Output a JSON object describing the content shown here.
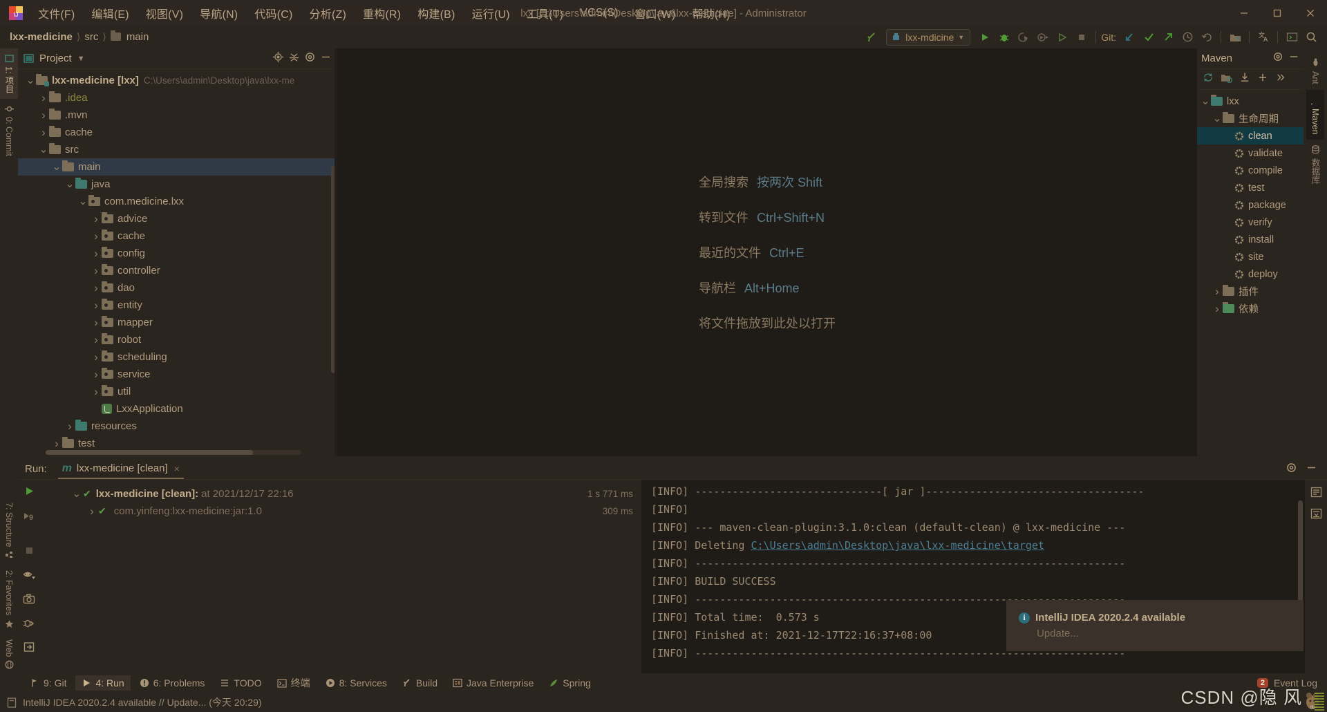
{
  "titlebar": {
    "window_title": "lxx [C:\\Users\\admin\\Desktop\\java\\lxx-medicine] - Administrator",
    "menus": [
      {
        "label": "文件(F)"
      },
      {
        "label": "编辑(E)"
      },
      {
        "label": "视图(V)"
      },
      {
        "label": "导航(N)"
      },
      {
        "label": "代码(C)"
      },
      {
        "label": "分析(Z)"
      },
      {
        "label": "重构(R)"
      },
      {
        "label": "构建(B)"
      },
      {
        "label": "运行(U)"
      },
      {
        "label": "工具(T)"
      },
      {
        "label": "VCS(S)"
      },
      {
        "label": "窗口(W)"
      },
      {
        "label": "帮助(H)"
      }
    ],
    "window_controls": [
      "minimize-button",
      "maximize-button",
      "close-button"
    ]
  },
  "navbar": {
    "breadcrumbs": [
      {
        "label": "lxx-medicine",
        "bold": true
      },
      {
        "label": "src",
        "bold": false
      },
      {
        "label": "main",
        "bold": false,
        "folder": true
      }
    ],
    "run_config": "lxx-mdicine",
    "git_label": "Git:",
    "toolbar_icons": [
      "build-hammer-icon",
      "run-button",
      "debug-button",
      "run-coverage-icon",
      "profiler-icon",
      "attach-icon",
      "stop-button",
      "update-project-icon",
      "commit-icon",
      "push-icon",
      "history-icon",
      "rollback-icon",
      "project-structure-icon",
      "translate-icon",
      "terminal-icon",
      "search-icon"
    ]
  },
  "left_tool_tabs": [
    {
      "label": "1: 项目",
      "active": true,
      "icon": "project-icon"
    },
    {
      "label": "0: Commit",
      "active": false,
      "icon": "commit-icon"
    }
  ],
  "left_tool_tabs_bottom": [
    {
      "label": "7: Structure",
      "icon": "structure-icon"
    },
    {
      "label": "2: Favorites",
      "icon": "star-icon"
    },
    {
      "label": "Web",
      "icon": "globe-icon"
    }
  ],
  "project_panel": {
    "title": "Project",
    "header_icons": [
      "locate-target-icon",
      "collapse-all-icon",
      "gear-icon",
      "hide-icon"
    ],
    "tree": [
      {
        "depth": 0,
        "arrow": "down",
        "icon": "module-folder",
        "label": "lxx-medicine [lxx]",
        "bold": true,
        "path": "C:\\Users\\admin\\Desktop\\java\\lxx-me"
      },
      {
        "depth": 1,
        "arrow": "right",
        "icon": "folder",
        "label": ".idea",
        "yellow": true
      },
      {
        "depth": 1,
        "arrow": "right",
        "icon": "folder",
        "label": ".mvn"
      },
      {
        "depth": 1,
        "arrow": "right",
        "icon": "folder",
        "label": "cache"
      },
      {
        "depth": 1,
        "arrow": "down",
        "icon": "folder",
        "label": "src"
      },
      {
        "depth": 2,
        "arrow": "down",
        "icon": "folder",
        "label": "main",
        "selected": true
      },
      {
        "depth": 3,
        "arrow": "down",
        "icon": "source-folder",
        "label": "java"
      },
      {
        "depth": 4,
        "arrow": "down",
        "icon": "package",
        "label": "com.medicine.lxx"
      },
      {
        "depth": 5,
        "arrow": "right",
        "icon": "package",
        "label": "advice"
      },
      {
        "depth": 5,
        "arrow": "right",
        "icon": "package",
        "label": "cache"
      },
      {
        "depth": 5,
        "arrow": "right",
        "icon": "package",
        "label": "config"
      },
      {
        "depth": 5,
        "arrow": "right",
        "icon": "package",
        "label": "controller"
      },
      {
        "depth": 5,
        "arrow": "right",
        "icon": "package",
        "label": "dao"
      },
      {
        "depth": 5,
        "arrow": "right",
        "icon": "package",
        "label": "entity"
      },
      {
        "depth": 5,
        "arrow": "right",
        "icon": "package",
        "label": "mapper"
      },
      {
        "depth": 5,
        "arrow": "right",
        "icon": "package",
        "label": "robot"
      },
      {
        "depth": 5,
        "arrow": "right",
        "icon": "package",
        "label": "scheduling"
      },
      {
        "depth": 5,
        "arrow": "right",
        "icon": "package",
        "label": "service"
      },
      {
        "depth": 5,
        "arrow": "right",
        "icon": "package",
        "label": "util"
      },
      {
        "depth": 5,
        "arrow": "none",
        "icon": "java-class",
        "label": "LxxApplication"
      },
      {
        "depth": 3,
        "arrow": "right",
        "icon": "resource-folder",
        "label": "resources"
      },
      {
        "depth": 2,
        "arrow": "right",
        "icon": "folder",
        "label": "test"
      }
    ]
  },
  "editor": {
    "welcome_rows": [
      {
        "action": "全局搜索",
        "key": "按两次 Shift"
      },
      {
        "action": "转到文件",
        "key": "Ctrl+Shift+N"
      },
      {
        "action": "最近的文件",
        "key": "Ctrl+E"
      },
      {
        "action": "导航栏",
        "key": "Alt+Home"
      }
    ],
    "drop_hint": "将文件拖放到此处以打开"
  },
  "maven_panel": {
    "title": "Maven",
    "header_icons": [
      "gear-icon",
      "hide-icon"
    ],
    "toolbar_icons": [
      "reload-icon",
      "add-module-icon",
      "download-sources-icon",
      "plus-icon",
      "more-icon"
    ],
    "tree": [
      {
        "depth": 0,
        "arrow": "down",
        "icon": "maven-project-icon",
        "label": "lxx"
      },
      {
        "depth": 1,
        "arrow": "down",
        "icon": "lifecycle-folder-icon",
        "label": "生命周期"
      },
      {
        "depth": 2,
        "arrow": "none",
        "icon": "gear-icon",
        "label": "clean",
        "selected": true
      },
      {
        "depth": 2,
        "arrow": "none",
        "icon": "gear-icon",
        "label": "validate"
      },
      {
        "depth": 2,
        "arrow": "none",
        "icon": "gear-icon",
        "label": "compile"
      },
      {
        "depth": 2,
        "arrow": "none",
        "icon": "gear-icon",
        "label": "test"
      },
      {
        "depth": 2,
        "arrow": "none",
        "icon": "gear-icon",
        "label": "package"
      },
      {
        "depth": 2,
        "arrow": "none",
        "icon": "gear-icon",
        "label": "verify"
      },
      {
        "depth": 2,
        "arrow": "none",
        "icon": "gear-icon",
        "label": "install"
      },
      {
        "depth": 2,
        "arrow": "none",
        "icon": "gear-icon",
        "label": "site"
      },
      {
        "depth": 2,
        "arrow": "none",
        "icon": "gear-icon",
        "label": "deploy"
      },
      {
        "depth": 1,
        "arrow": "right",
        "icon": "plugins-folder-icon",
        "label": "插件"
      },
      {
        "depth": 1,
        "arrow": "right",
        "icon": "dependencies-icon",
        "label": "依赖"
      }
    ]
  },
  "right_tool_tabs": [
    {
      "label": "Ant",
      "active": false,
      "icon": "ant-icon"
    },
    {
      "label": "Maven",
      "active": true,
      "icon": "maven-m-icon"
    },
    {
      "label": "数据库",
      "active": false,
      "icon": "database-icon"
    }
  ],
  "run_panel": {
    "label": "Run:",
    "tab_title": "lxx-medicine [clean]",
    "tab_close": "×",
    "header_icons": [
      "gear-icon",
      "hide-icon"
    ],
    "gutter_icons": [
      "rerun-button",
      "rerun-failed-icon",
      "stop-button",
      "toggle-visibility-icon",
      "screenshot-icon",
      "debug-bug-icon",
      "export-icon",
      "more-icon"
    ],
    "right_gutter_icons": [
      "wrap-text-icon",
      "scroll-to-end-icon"
    ],
    "tree": [
      {
        "depth": 0,
        "arrow": "down",
        "name": "lxx-medicine [clean]:",
        "meta": "at 2021/12/17 22:16",
        "time": "1 s 771 ms"
      },
      {
        "depth": 1,
        "arrow": "right",
        "name": "",
        "meta": "com.yinfeng:lxx-medicine:jar:1.0",
        "time": "309 ms"
      }
    ],
    "console_lines": [
      {
        "text": "[INFO] ------------------------------[ jar ]-----------------------------------"
      },
      {
        "text": "[INFO] "
      },
      {
        "text": "[INFO] --- maven-clean-plugin:3.1.0:clean (default-clean) @ lxx-medicine ---"
      },
      {
        "text": "[INFO] Deleting ",
        "link": "C:\\Users\\admin\\Desktop\\java\\lxx-medicine\\target"
      },
      {
        "text": "[INFO] ---------------------------------------------------------------------"
      },
      {
        "text": "[INFO] BUILD SUCCESS"
      },
      {
        "text": "[INFO] ---------------------------------------------------------------------"
      },
      {
        "text": "[INFO] Total time:  0.573 s"
      },
      {
        "text": "[INFO] Finished at: 2021-12-17T22:16:37+08:00"
      },
      {
        "text": "[INFO] ---------------------------------------------------------------------"
      }
    ]
  },
  "notification": {
    "title": "IntelliJ IDEA 2020.2.4 available",
    "link": "Update...",
    "icon": "info-icon"
  },
  "toolwindow_bar": [
    {
      "label": "9: Git",
      "icon": "git-icon",
      "active": false
    },
    {
      "label": "4: Run",
      "icon": "run-icon",
      "active": true
    },
    {
      "label": "6: Problems",
      "icon": "problems-icon",
      "active": false
    },
    {
      "label": "TODO",
      "icon": "todo-icon",
      "active": false
    },
    {
      "label": "终端",
      "icon": "terminal-icon",
      "active": false
    },
    {
      "label": "8: Services",
      "icon": "services-icon",
      "active": false
    },
    {
      "label": "Build",
      "icon": "build-hammer-icon",
      "active": false
    },
    {
      "label": "Java Enterprise",
      "icon": "java-enterprise-icon",
      "active": false
    },
    {
      "label": "Spring",
      "icon": "spring-leaf-icon",
      "active": false
    }
  ],
  "event_log": {
    "label": "Event Log",
    "badge": "2"
  },
  "statusbar": {
    "message": "IntelliJ IDEA 2020.2.4 available // Update... (今天 20:29)",
    "icon": "notification-icon"
  },
  "watermark": {
    "text": "CSDN @隐 风"
  }
}
